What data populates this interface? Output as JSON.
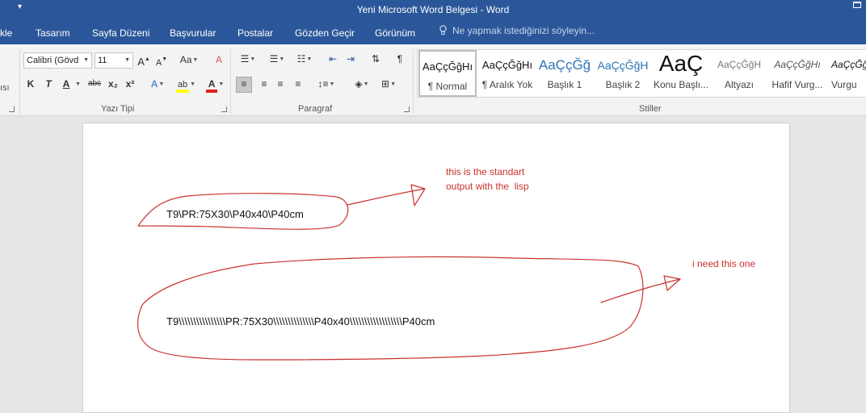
{
  "titlebar": {
    "title": "Yeni Microsoft Word Belgesi - Word"
  },
  "tabs": [
    "kle",
    "Tasarım",
    "Sayfa Düzeni",
    "Başvurular",
    "Postalar",
    "Gözden Geçir",
    "Görünüm"
  ],
  "tellme": {
    "text": "Ne yapmak istediğinizi söyleyin..."
  },
  "left_partial": {
    "label": "ısı"
  },
  "font": {
    "name": "Calibri (Gövd",
    "size": "11",
    "format_buttons": [
      "K",
      "T",
      "A",
      "abc",
      "x₂",
      "x²"
    ]
  },
  "groups": {
    "font": "Yazı Tipi",
    "paragraph": "Paragraf",
    "styles": "Stiller"
  },
  "styles_gallery": [
    {
      "sample": "AaÇçĞğHı",
      "name": "¶ Normal",
      "color": "#111111"
    },
    {
      "sample": "AaÇçĞğHı",
      "name": "¶ Aralık Yok",
      "color": "#111111"
    },
    {
      "sample": "AaÇçĞğ",
      "name": "Başlık 1",
      "color": "#2e74b5"
    },
    {
      "sample": "AaÇçĞğH",
      "name": "Başlık 2",
      "color": "#2e74b5"
    },
    {
      "sample": "AaÇ",
      "name": "Konu Başlı...",
      "color": "#111111"
    },
    {
      "sample": "AaÇçĞğH",
      "name": "Altyazı",
      "color": "#7a7a7a"
    },
    {
      "sample": "AaÇçĞğHı",
      "name": "Hafif Vurg...",
      "color": "#555555"
    },
    {
      "sample": "AaÇçĞğ",
      "name": "Vurgu",
      "color": "#111111"
    }
  ],
  "document": {
    "line1": "T9\\PR:75X30\\P40x40\\P40cm",
    "line2": "T9\\\\\\\\\\\\\\\\\\\\\\\\\\\\\\\\PR:75X30\\\\\\\\\\\\\\\\\\\\\\\\\\\\P40x40\\\\\\\\\\\\\\\\\\\\\\\\\\\\\\\\\\\\P40cm",
    "annotation1": "this is the standart\noutput with the  lisp",
    "annotation2": "i need this one"
  },
  "colors": {
    "accent": "#2b579a",
    "ink": "#c9322f",
    "highlight": "#ffff00",
    "font_color": "#e0201b"
  }
}
